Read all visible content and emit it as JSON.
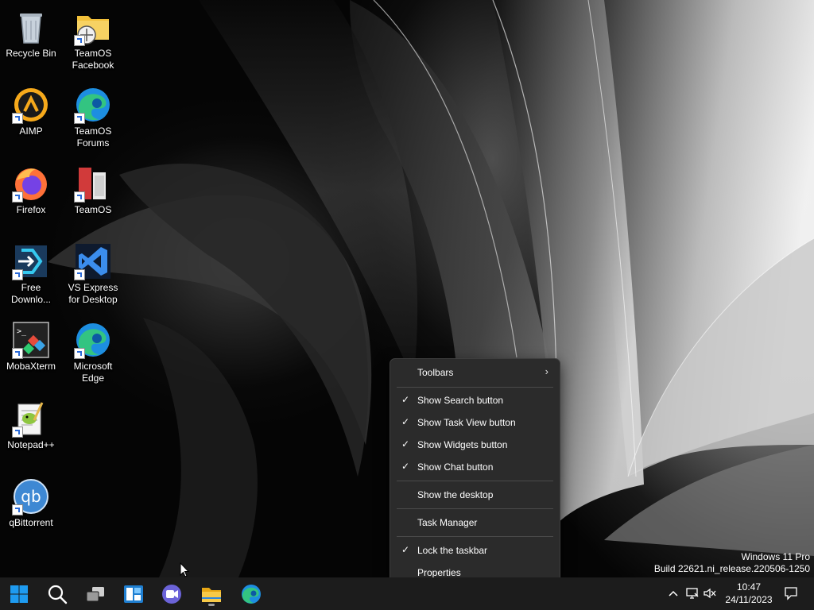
{
  "desktop": {
    "icons": [
      {
        "label": "Recycle Bin",
        "icon": "recycle-bin-icon"
      },
      {
        "label": "TeamOS Facebook",
        "icon": "folder-icon"
      },
      {
        "label": "AIMP",
        "icon": "aimp-icon"
      },
      {
        "label": "TeamOS Forums",
        "icon": "edge-icon"
      },
      {
        "label": "Firefox",
        "icon": "firefox-icon"
      },
      {
        "label": "TeamOS",
        "icon": "teamos-icon"
      },
      {
        "label": "Free Downlo...",
        "icon": "free-download-manager-icon"
      },
      {
        "label": "VS Express for Desktop",
        "icon": "visual-studio-icon"
      },
      {
        "label": "MobaXterm",
        "icon": "mobaxterm-icon"
      },
      {
        "label": "Microsoft Edge",
        "icon": "edge-icon"
      },
      {
        "label": "Notepad++",
        "icon": "notepad-plus-plus-icon"
      },
      {
        "label": "qBittorrent",
        "icon": "qbittorrent-icon"
      }
    ]
  },
  "context_menu": {
    "items": [
      {
        "label": "Toolbars",
        "checked": false,
        "submenu": true
      },
      {
        "label": "Show Search button",
        "checked": true
      },
      {
        "label": "Show Task View button",
        "checked": true
      },
      {
        "label": "Show Widgets button",
        "checked": true
      },
      {
        "label": "Show Chat button",
        "checked": true
      },
      {
        "label": "Show the desktop",
        "checked": false
      },
      {
        "label": "Task Manager",
        "checked": false
      },
      {
        "label": "Lock the taskbar",
        "checked": true
      },
      {
        "label": "Properties",
        "checked": false
      }
    ],
    "check_glyph": "✓",
    "submenu_glyph": "›"
  },
  "watermark": {
    "line1": "Windows 11 Pro",
    "line2": "Build 22621.ni_release.220506-1250"
  },
  "taskbar": {
    "buttons": [
      "start-icon",
      "search-icon",
      "task-view-icon",
      "widgets-icon",
      "chat-icon",
      "file-explorer-icon",
      "edge-icon"
    ],
    "tray": {
      "time": "10:47",
      "date": "24/11/2023",
      "icons": [
        "chevron-up-icon",
        "network-icon",
        "volume-muted-icon",
        "notification-icon"
      ]
    }
  },
  "colors": {
    "menu_bg": "#2b2b2b",
    "taskbar_bg": "#1c1c1c",
    "accent_blue": "#0078d4"
  }
}
